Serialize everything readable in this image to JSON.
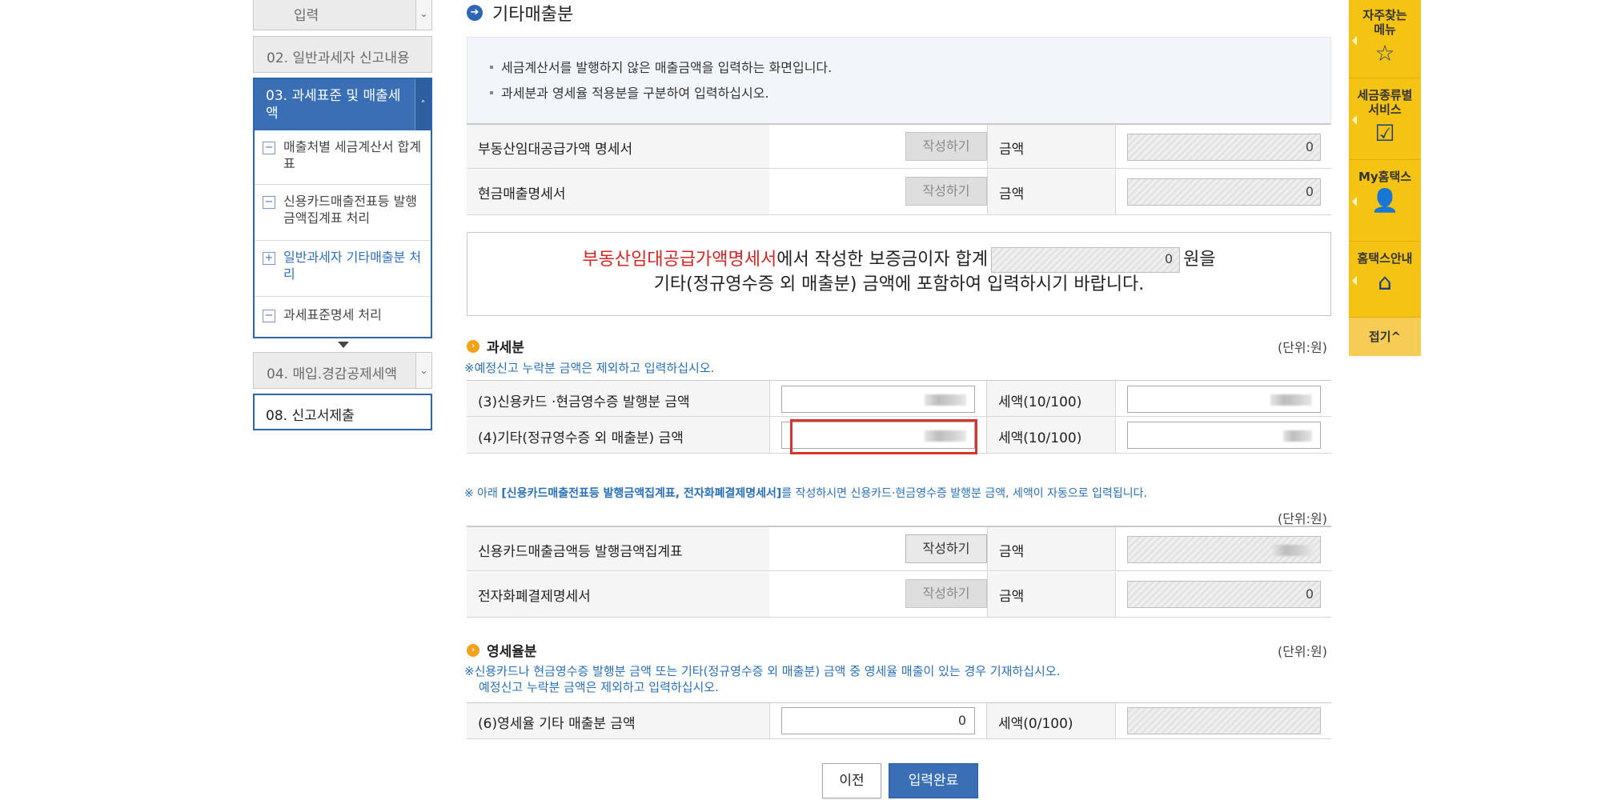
{
  "left_nav": {
    "top_item_label": "입력",
    "item02_label": "02. 일반과세자 신고내용",
    "item03_label": "03. 과세표준 및 매출세액",
    "subitems": [
      {
        "icon": "−",
        "label": "매출처별 세금계산서 합계표"
      },
      {
        "icon": "−",
        "label": "신용카드매출전표등 발행금액집계표 처리"
      },
      {
        "icon": "+",
        "label": "일반과세자 기타매출분 처리"
      },
      {
        "icon": "−",
        "label": "과세표준명세 처리"
      }
    ],
    "item04_label": "04. 매입.경감공제세액",
    "item08_label": "08. 신고서제출"
  },
  "section_title": "기타매출분",
  "info_lines": [
    "세금계산서를 발행하지 않은 매출금액을 입력하는 화면입니다.",
    "과세분과 영세율 적용분을 구분하여 입력하십시오."
  ],
  "statements": [
    {
      "label": "부동산임대공급가액 명세서",
      "button": "작성하기",
      "amount_label": "금액",
      "amount": "0"
    },
    {
      "label": "현금매출명세서",
      "button": "작성하기",
      "amount_label": "금액",
      "amount": "0"
    }
  ],
  "notice": {
    "red_text": "부동산임대공급가액명세서",
    "text_a": "에서 작성한 보증금이자 합계",
    "value": "0",
    "text_b": "원을",
    "line2": "기타(정규영수증 외 매출분) 금액에 포함하여 입력하시기 바랍니다."
  },
  "taxable": {
    "title": "과세분",
    "unit": "(단위:원)",
    "note": "※예정신고 누락분 금액은 제외하고 입력하십시오.",
    "rows": [
      {
        "label": "(3)신용카드 ·현금영수증 발행분 금액",
        "tax_label": "세액(10/100)"
      },
      {
        "label": "(4)기타(정규영수증 외 매출분) 금액",
        "tax_label": "세액(10/100)"
      }
    ]
  },
  "auto_note": {
    "prefix": "※ 아래 ",
    "bold": "[신용카드매출전표등 발행금액집계표, 전자화폐결제명세서]",
    "suffix": "를 작성하시면 신용카드·현금영수증 발행분 금액, 세액이 자동으로 입력됩니다.",
    "unit": "(단위:원)"
  },
  "auto_rows": [
    {
      "label": "신용카드매출금액등 발행금액집계표",
      "button": "작성하기",
      "amount_label": "금액",
      "amount": ""
    },
    {
      "label": "전자화폐결제명세서",
      "button": "작성하기",
      "amount_label": "금액",
      "amount": "0"
    }
  ],
  "zero_rate": {
    "title": "영세율분",
    "unit": "(단위:원)",
    "note1": "※신용카드나 현금영수증 발행분 금액 또는 기타(정규영수증 외 매출분) 금액 중 영세율 매출이 있는 경우 기재하십시오.",
    "note2": "예정신고 누락분 금액은 제외하고 입력하십시오.",
    "row_label": "(6)영세율 기타 매출분 금액",
    "row_value": "0",
    "tax_label": "세액(0/100)"
  },
  "buttons": {
    "prev": "이전",
    "done": "입력완료"
  },
  "right_bar": {
    "items": [
      {
        "label": "자주찾는 메뉴",
        "icon": "☆"
      },
      {
        "label": "세금종류별 서비스",
        "icon": "☑"
      },
      {
        "label": "My홈택스",
        "icon": "👤"
      },
      {
        "label": "홈택스안내",
        "icon": "⌂"
      }
    ],
    "fold": "접기^"
  },
  "colors": {
    "primary": "#3a6fb5",
    "accent_yellow": "#f5c314",
    "alert_red": "#d9342b",
    "note_blue": "#2a6fb5"
  }
}
